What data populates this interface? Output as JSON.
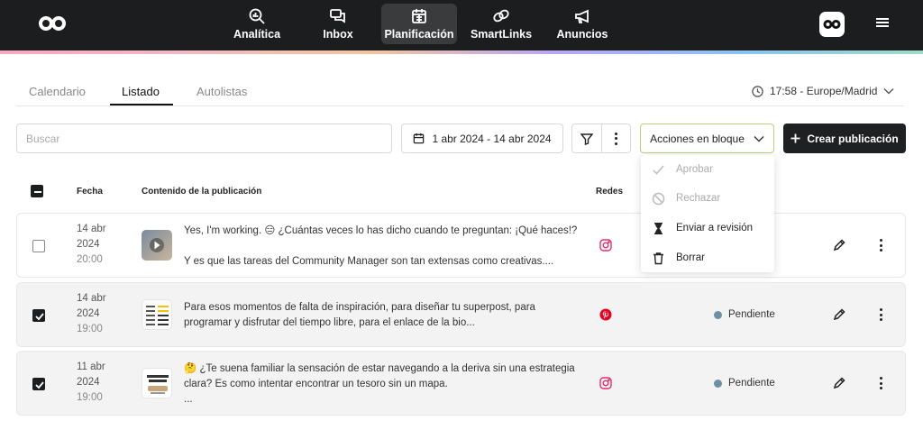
{
  "nav": {
    "items": [
      {
        "label": "Analítica",
        "icon": "analytics-icon"
      },
      {
        "label": "Inbox",
        "icon": "inbox-icon"
      },
      {
        "label": "Planificación",
        "icon": "calendar-icon",
        "active": true
      },
      {
        "label": "SmartLinks",
        "icon": "link-icon"
      },
      {
        "label": "Anuncios",
        "icon": "megaphone-icon"
      }
    ]
  },
  "tabs": [
    {
      "label": "Calendario"
    },
    {
      "label": "Listado",
      "active": true
    },
    {
      "label": "Autolistas"
    }
  ],
  "timezone": "17:58 - Europe/Madrid",
  "search": {
    "placeholder": "Buscar",
    "value": ""
  },
  "date_range": "1 abr 2024 - 14 abr 2024",
  "bulk_actions": {
    "label": "Acciones en bloque",
    "items": [
      {
        "label": "Aprobar",
        "icon": "check-icon",
        "disabled": true
      },
      {
        "label": "Rechazar",
        "icon": "ban-icon",
        "disabled": true
      },
      {
        "label": "Enviar a revisión",
        "icon": "hourglass-icon",
        "disabled": false
      },
      {
        "label": "Borrar",
        "icon": "trash-icon",
        "disabled": false
      }
    ]
  },
  "create_label": "Crear publicación",
  "table": {
    "headers": {
      "date": "Fecha",
      "content": "Contenido de la publicación",
      "networks": "Redes"
    },
    "rows": [
      {
        "checked": false,
        "day": "14 abr",
        "year": "2024",
        "time": "20:00",
        "line1": "Yes, I'm working. 😑 ¿Cuántas veces lo has dicho cuando te preguntan: ¡Qué haces!?",
        "line2": "Y es que las tareas del Community Manager son tan extensas como creativas....",
        "line3": "",
        "network": "instagram",
        "status": ""
      },
      {
        "checked": true,
        "day": "14 abr",
        "year": "2024",
        "time": "19:00",
        "line1": "Para esos momentos de falta de inspiración, para diseñar tu superpost, para",
        "line2": "programar y disfrutar del tiempo libre, para el enlace de la bio...",
        "line3": "",
        "network": "pinterest",
        "status": "Pendiente"
      },
      {
        "checked": true,
        "day": "11 abr",
        "year": "2024",
        "time": "19:00",
        "line1": "🤔 ¿Te suena familiar la sensación de estar navegando a la deriva sin una estrategia",
        "line2": "clara? Es como intentar encontrar un tesoro sin un mapa.",
        "line3": "...",
        "network": "instagram",
        "status": "Pendiente"
      }
    ]
  },
  "colors": {
    "topbar": "#1c1d1f",
    "instagram": "#e1306c",
    "pinterest": "#e60023",
    "status_dot": "#6f8fa2",
    "bulk_border": "#b9cf7a"
  }
}
